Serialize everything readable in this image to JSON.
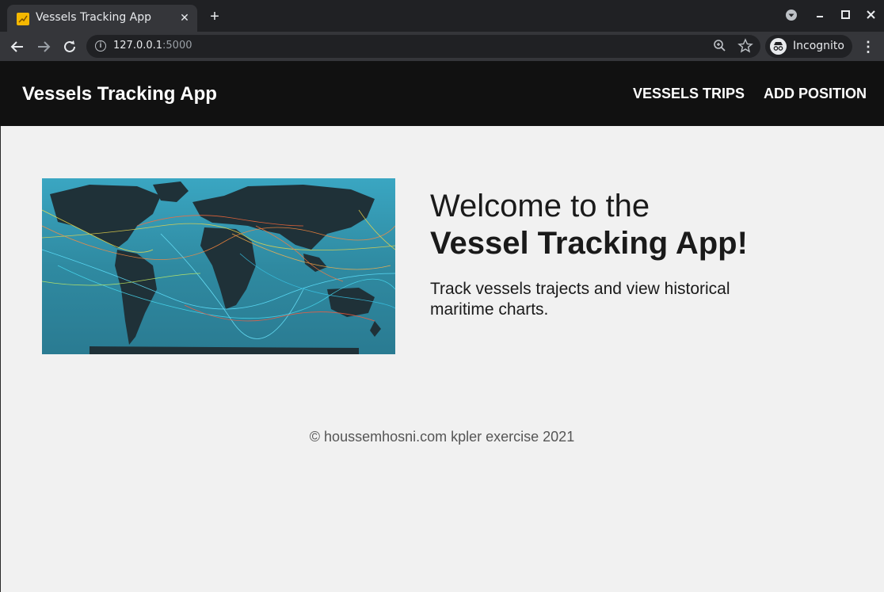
{
  "browser": {
    "tab_title": "Vessels Tracking App",
    "tab_close": "✕",
    "new_tab": "+",
    "url_host": "127.0.0.1",
    "url_port": ":5000",
    "incognito_label": "Incognito"
  },
  "header": {
    "brand": "Vessels Tracking App",
    "nav": [
      {
        "label": "VESSELS TRIPS"
      },
      {
        "label": "ADD POSITION"
      }
    ]
  },
  "hero": {
    "title_line1": "Welcome to the",
    "title_line2": "Vessel Tracking App!",
    "subtitle": "Track vessels trajects and view historical maritime charts.",
    "image_icon": "world-shipping-map"
  },
  "footer": {
    "text": "© houssemhosni.com kpler exercise 2021"
  },
  "colors": {
    "appbar": "#111111",
    "page_bg": "#f1f1f1",
    "map_ocean": "#3a8fa3"
  }
}
